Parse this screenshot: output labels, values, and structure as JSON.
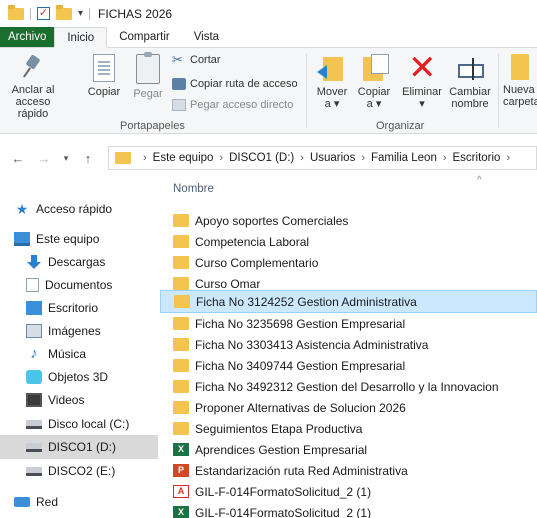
{
  "window": {
    "title": "FICHAS 2026"
  },
  "tabs": [
    {
      "label": "Archivo"
    },
    {
      "label": "Inicio"
    },
    {
      "label": "Compartir"
    },
    {
      "label": "Vista"
    }
  ],
  "ribbon": {
    "pin_label_1": "Anclar al",
    "pin_label_2": "acceso rápido",
    "copy_label": "Copiar",
    "paste_label": "Pegar",
    "cut_label": "Cortar",
    "copy_path_label": "Copiar ruta de acceso",
    "paste_shortcut_label": "Pegar acceso directo",
    "group_clipboard": "Portapapeles",
    "move_label": "Mover",
    "move_sub": "a ▾",
    "copy_to_label": "Copiar",
    "copy_to_sub": "a ▾",
    "delete_label": "Eliminar",
    "delete_sub": "▾",
    "rename_label": "Cambiar",
    "rename_sub": "nombre",
    "group_organize": "Organizar",
    "new_folder_label": "Nueva",
    "new_folder_sub": "carpeta"
  },
  "breadcrumb": [
    "Este equipo",
    "DISCO1 (D:)",
    "Usuarios",
    "Familia Leon",
    "Escritorio"
  ],
  "nav_pane": [
    {
      "label": "Acceso rápido",
      "icon": "star-icon"
    },
    {
      "label": "Este equipo",
      "icon": "computer-icon"
    },
    {
      "label": "Descargas",
      "icon": "download-icon"
    },
    {
      "label": "Documentos",
      "icon": "documents-icon"
    },
    {
      "label": "Escritorio",
      "icon": "desktop-icon"
    },
    {
      "label": "Imágenes",
      "icon": "pictures-icon"
    },
    {
      "label": "Música",
      "icon": "music-icon"
    },
    {
      "label": "Objetos 3D",
      "icon": "objects-3d-icon"
    },
    {
      "label": "Videos",
      "icon": "videos-icon"
    },
    {
      "label": "Disco local (C:)",
      "icon": "drive-icon"
    },
    {
      "label": "DISCO1 (D:)",
      "icon": "drive-icon",
      "selected": true
    },
    {
      "label": "DISCO2 (E:)",
      "icon": "drive-icon"
    },
    {
      "label": "Red",
      "icon": "network-icon"
    }
  ],
  "file_list": {
    "column_header": "Nombre",
    "files": [
      {
        "name": "Apoyo soportes Comerciales",
        "type": "folder"
      },
      {
        "name": "Competencia Laboral",
        "type": "folder"
      },
      {
        "name": "Curso Complementario",
        "type": "folder"
      },
      {
        "name": "Curso Omar",
        "type": "folder"
      },
      {
        "name": "Ficha No 3124252 Gestion Administrativa",
        "type": "folder",
        "selected": true
      },
      {
        "name": "Ficha No 3235698 Gestion Empresarial",
        "type": "folder"
      },
      {
        "name": "Ficha No 3303413  Asistencia Administrativa",
        "type": "folder"
      },
      {
        "name": "Ficha No 3409744 Gestion Empresarial",
        "type": "folder"
      },
      {
        "name": "Ficha No 3492312   Gestion del Desarrollo  y la Innovacion",
        "type": "folder"
      },
      {
        "name": "Proponer Alternativas de Solucion 2026",
        "type": "folder"
      },
      {
        "name": "Seguimientos Etapa Productiva",
        "type": "folder"
      },
      {
        "name": "Aprendices Gestion Empresarial",
        "type": "excel"
      },
      {
        "name": "Estandarización ruta Red Administrativa",
        "type": "powerpoint"
      },
      {
        "name": "GIL-F-014FormatoSolicitud_2 (1)",
        "type": "pdf"
      },
      {
        "name": "GIL-F-014FormatoSolicitud_2 (1)",
        "type": "excel"
      }
    ]
  },
  "colors": {
    "file_tab": "#1b6e2d",
    "folder": "#f3c44f",
    "selection": "#cce8ff",
    "nav_selection": "#d9d9d9"
  }
}
